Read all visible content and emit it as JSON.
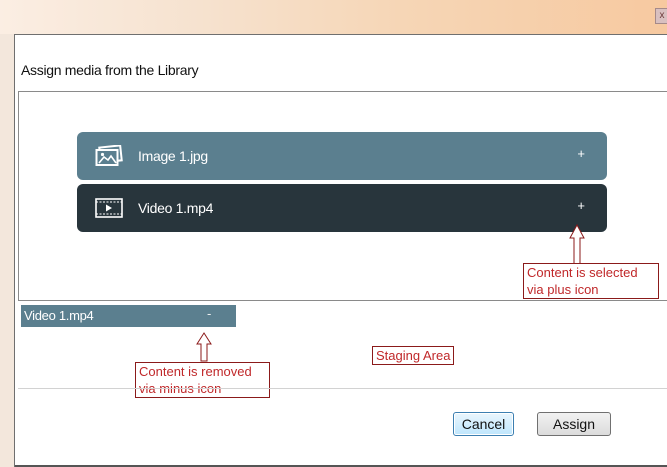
{
  "window": {
    "close_glyph": "x"
  },
  "dialog": {
    "title": "Assign media from the Library",
    "library_items": [
      {
        "icon": "image-icon",
        "label": "Image 1.jpg",
        "action": "+"
      },
      {
        "icon": "film-icon",
        "label": "Video 1.mp4",
        "action": "+"
      }
    ],
    "staging": {
      "items": [
        {
          "label": "Video 1.mp4",
          "action": "-"
        }
      ]
    },
    "buttons": {
      "cancel": "Cancel",
      "assign": "Assign"
    }
  },
  "annotations": {
    "select_line1": "Content is selected",
    "select_line2": "via plus icon",
    "remove_line1": "Content is removed",
    "remove_line2": "via minus icon",
    "staging_label": "Staging Area"
  },
  "colors": {
    "image_row": "#5b7f8f",
    "video_row": "#28353c",
    "callout_text": "#c0282a",
    "callout_border": "#8b1a1a"
  }
}
